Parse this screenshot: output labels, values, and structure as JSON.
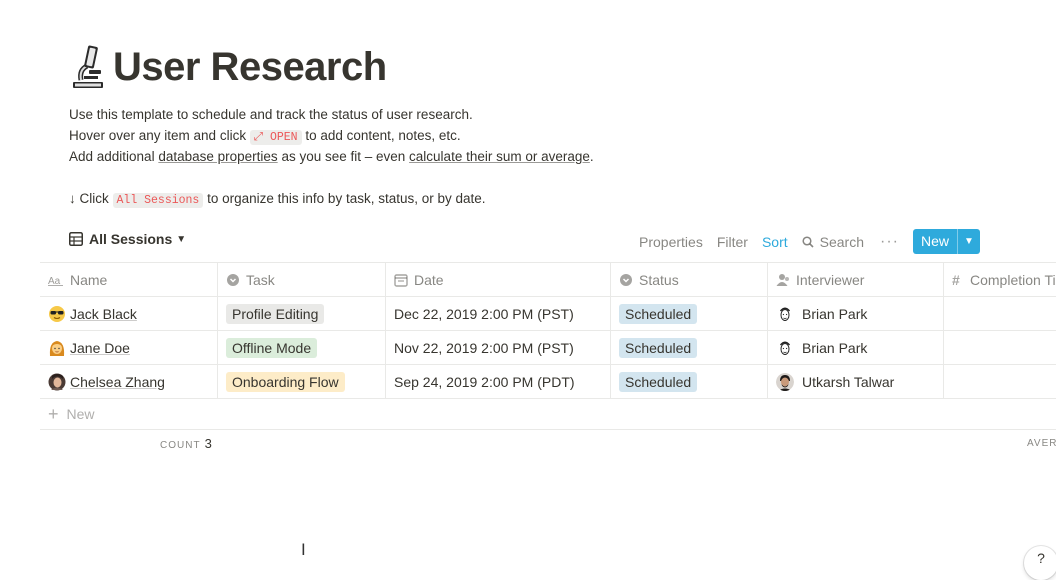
{
  "page": {
    "title": "User Research",
    "icon": "microscope-icon"
  },
  "description": {
    "line1": "Use this template to schedule and track the status of user research.",
    "line2_before": "Hover over any item and click",
    "line2_code": "⤢ OPEN",
    "line2_after": "to add content, notes, etc.",
    "line3_before": "Add additional",
    "line3_link1": "database properties",
    "line3_middle": "as you see fit – even",
    "line3_link2": "calculate their sum or average",
    "line3_end": ".",
    "line4_before": "↓ Click",
    "line4_code": "All Sessions",
    "line4_after": "to organize this info by task, status, or by date."
  },
  "toolbar": {
    "view_name": "All Sessions",
    "properties": "Properties",
    "filter": "Filter",
    "sort": "Sort",
    "search": "Search",
    "more": "···",
    "new": "New",
    "accent_color": "#2eaadc"
  },
  "table": {
    "columns": [
      "Name",
      "Task",
      "Date",
      "Status",
      "Interviewer",
      "Completion Ti"
    ],
    "rows": [
      {
        "name": "Jack Black",
        "emoji": "sunglasses-face-icon",
        "task": "Profile Editing",
        "task_color": "#e9e9e7",
        "date": "Dec 22, 2019 2:00 PM (PST)",
        "status": "Scheduled",
        "status_color": "#d3e5ef",
        "interviewer": "Brian Park",
        "avatar": "sketch-avatar-icon"
      },
      {
        "name": "Jane Doe",
        "emoji": "woman-icon",
        "task": "Offline Mode",
        "task_color": "#dbeddb",
        "date": "Nov 22, 2019 2:00 PM (PST)",
        "status": "Scheduled",
        "status_color": "#d3e5ef",
        "interviewer": "Brian Park",
        "avatar": "sketch-avatar-icon"
      },
      {
        "name": "Chelsea Zhang",
        "emoji": "photo-avatar-icon",
        "task": "Onboarding Flow",
        "task_color": "#fdecc8",
        "date": "Sep 24, 2019 2:00 PM (PDT)",
        "status": "Scheduled",
        "status_color": "#d3e5ef",
        "interviewer": "Utkarsh Talwar",
        "avatar": "photo-avatar-icon"
      }
    ],
    "new_row": "New",
    "count_label": "COUNT",
    "count_value": "3",
    "average_label": "AVERA"
  },
  "help": "?",
  "cursor": "I"
}
